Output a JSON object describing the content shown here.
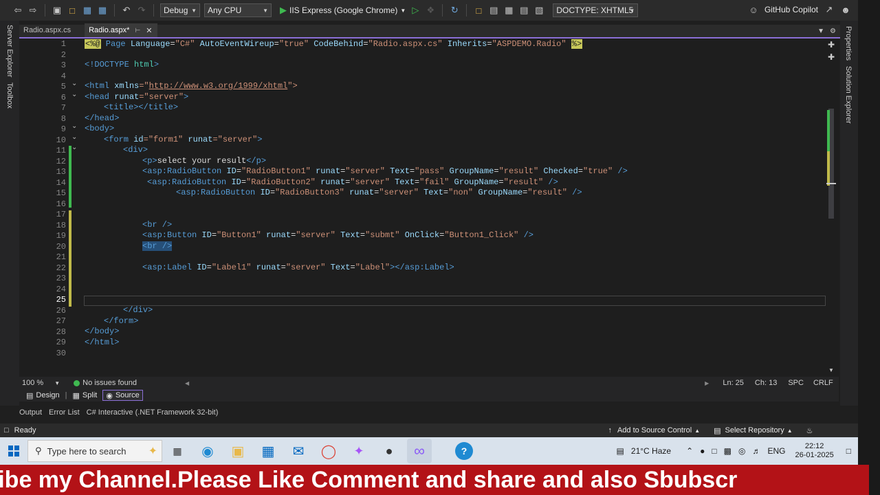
{
  "toolbar": {
    "config": "Debug",
    "platform": "Any CPU",
    "run_target": "IIS Express (Google Chrome)",
    "doctype": "DOCTYPE: XHTML5",
    "copilot": "GitHub Copilot"
  },
  "side": {
    "left": [
      "Server Explorer",
      "Toolbox"
    ],
    "right": [
      "Properties",
      "Solution Explorer"
    ]
  },
  "tabs": [
    {
      "label": "Radio.aspx.cs"
    },
    {
      "label": "Radio.aspx*"
    }
  ],
  "editor": {
    "current_line": 25,
    "lines": [
      "1",
      "2",
      "3",
      "4",
      "5",
      "6",
      "7",
      "8",
      "9",
      "10",
      "11",
      "12",
      "13",
      "14",
      "15",
      "16",
      "17",
      "18",
      "19",
      "20",
      "21",
      "22",
      "23",
      "24",
      "25",
      "26",
      "27",
      "28",
      "29",
      "30"
    ],
    "code": {
      "l1_a": "<%@",
      "l1_b": " Page ",
      "l1_c": "Language",
      "l1_d": "=",
      "l1_e": "\"C#\"",
      "l1_f": " AutoEventWireup",
      "l1_g": "\"true\"",
      "l1_h": " CodeBehind",
      "l1_i": "\"Radio.aspx.cs\"",
      "l1_j": " Inherits",
      "l1_k": "\"ASPDEMO.Radio\"",
      "l1_l": "%>",
      "l3": "<!DOCTYPE html>",
      "l3_a": "<!DOCTYPE ",
      "l3_b": "html",
      "l3_c": ">",
      "l5_a": "<html ",
      "l5_b": "xmlns",
      "l5_c": "=\"",
      "l5_d": "http://www.w3.org/1999/xhtml",
      "l5_e": "\">",
      "l6_a": "<head ",
      "l6_b": "runat",
      "l6_c": "=\"server\"",
      "l6_d": ">",
      "l7_a": "<title></title>",
      "l8": "</head>",
      "l9": "<body>",
      "l10_a": "<form ",
      "l10_b": "id",
      "l10_c": "=\"form1\"",
      "l10_d": " runat",
      "l10_e": "=\"server\"",
      "l10_f": ">",
      "l11": "<div>",
      "l12_a": "<p>",
      "l12_b": "select your result",
      "l12_c": "</p>",
      "l13": {
        "tag": "asp:RadioButton",
        "id": "\"RadioButton1\"",
        "runat": "\"server\"",
        "text": "\"pass\"",
        "group": "\"result\"",
        "checked": "\"true\""
      },
      "l14": {
        "tag": "asp:RadioButton",
        "id": "\"RadioButton2\"",
        "runat": "\"server\"",
        "text": "\"fail\"",
        "group": "\"result\""
      },
      "l15": {
        "tag": "asp:RadioButton",
        "id": "\"RadioButton3\"",
        "runat": "\"server\"",
        "text": "\"non\"",
        "group": "\"result\""
      },
      "l18": "<br />",
      "l19": {
        "tag": "asp:Button",
        "id": "\"Button1\"",
        "runat": "\"server\"",
        "text": "\"submt\"",
        "onclick": "\"Button1_Click\""
      },
      "l20": "<br />",
      "l22": {
        "tag": "asp:Label",
        "id": "\"Label1\"",
        "runat": "\"server\"",
        "text": "\"Label\"",
        "close": "</asp:Label>"
      },
      "l26": "</div>",
      "l27": "</form>",
      "l28": "</body>",
      "l29": "</html>"
    },
    "attr_names": {
      "id": "ID",
      "runat": "runat",
      "text": "Text",
      "group": "GroupName",
      "checked": "Checked",
      "onclick": "OnClick"
    }
  },
  "editor_status": {
    "zoom": "100 %",
    "issues": "No issues found",
    "ln": "Ln: 25",
    "ch": "Ch: 13",
    "spc": "SPC",
    "crlf": "CRLF"
  },
  "views": {
    "design": "Design",
    "split": "Split",
    "source": "Source"
  },
  "output_tabs": [
    "Output",
    "Error List",
    "C# Interactive (.NET Framework 32-bit)"
  ],
  "status": {
    "ready": "Ready",
    "source_control": "Add to Source Control",
    "repo": "Select Repository"
  },
  "taskbar": {
    "search_placeholder": "Type here to search",
    "weather": "21°C  Haze",
    "lang": "ENG",
    "time": "22:12",
    "date": "26-01-2025"
  },
  "banner": "ribe my Channel.Please Like Comment and share and also Sbubscr",
  "colors": {
    "accent": "#8b6fd6",
    "banner": "#b31217",
    "ok": "#3fb950"
  }
}
